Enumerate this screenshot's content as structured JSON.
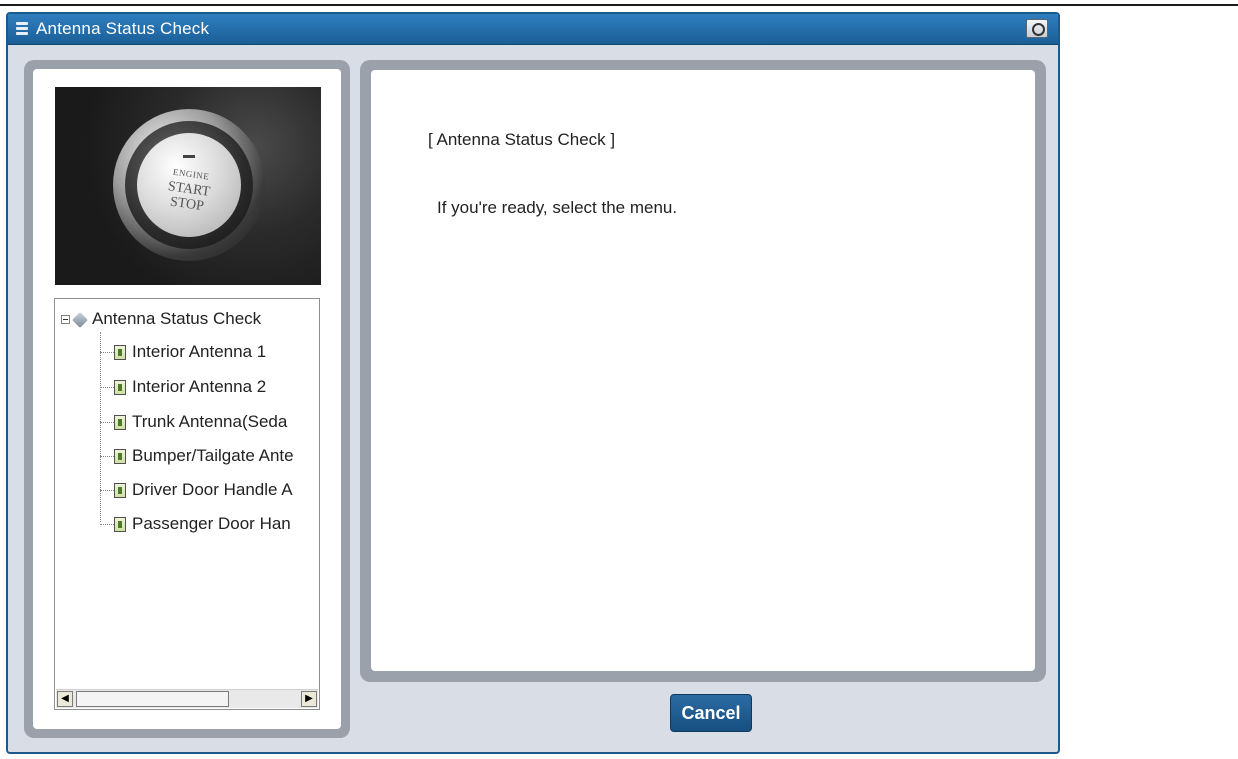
{
  "window": {
    "title": "Antenna Status Check"
  },
  "photo": {
    "engine": "ENGINE",
    "start": "START",
    "stop": "STOP"
  },
  "tree": {
    "root": "Antenna Status Check",
    "items": [
      "Interior Antenna 1",
      "Interior Antenna 2",
      "Trunk Antenna(Seda",
      "Bumper/Tailgate Ante",
      "Driver Door Handle A",
      "Passenger Door Han"
    ]
  },
  "content": {
    "heading": "[ Antenna Status Check ]",
    "message": "If you're ready, select the menu."
  },
  "buttons": {
    "cancel": "Cancel"
  },
  "colors": {
    "titlebar": "#1b5f98",
    "panel": "#9aa1ab",
    "cancel": "#1f5b8f"
  },
  "icons": {
    "title": "menu-icon",
    "camera": "camera-icon",
    "root": "diamond-icon",
    "item": "document-icon"
  }
}
